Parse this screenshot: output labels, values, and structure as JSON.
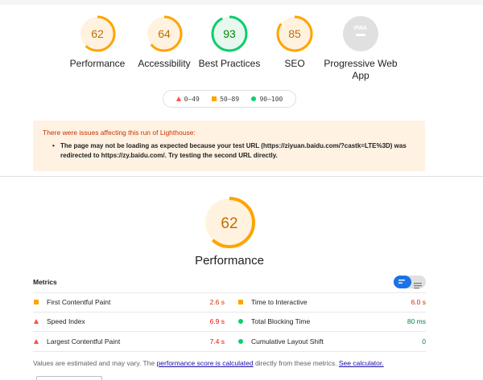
{
  "colors": {
    "orange": "#ffa400",
    "green": "#0cce6b",
    "red": "#ff4e42",
    "gray": "#9e9e9e",
    "link": "#1a0dab"
  },
  "summary": [
    {
      "score": "62",
      "label": "Performance",
      "status": "average",
      "fraction": 0.62
    },
    {
      "score": "64",
      "label": "Accessibility",
      "status": "average",
      "fraction": 0.64
    },
    {
      "score": "93",
      "label": "Best Practices",
      "status": "pass",
      "fraction": 0.93
    },
    {
      "score": "85",
      "label": "SEO",
      "status": "average",
      "fraction": 0.85
    },
    {
      "badge": "PWA",
      "label": "Progressive Web App",
      "status": "na"
    }
  ],
  "legend": [
    {
      "range": "0–49",
      "icon": "red-triangle-icon"
    },
    {
      "range": "50–89",
      "icon": "orange-square-icon"
    },
    {
      "range": "90–100",
      "icon": "green-circle-icon"
    }
  ],
  "warning": {
    "title": "There were issues affecting this run of Lighthouse:",
    "item": "The page may not be loading as expected because your test URL (https://ziyuan.baidu.com/?castk=LTE%3D) was redirected to https://zy.baidu.com/. Try testing the second URL directly."
  },
  "performance": {
    "score": "62",
    "fraction": 0.62,
    "title": "Performance"
  },
  "metrics": {
    "title": "Metrics",
    "items": [
      {
        "name": "First Contentful Paint",
        "value": "2.6 s",
        "status": "average"
      },
      {
        "name": "Time to Interactive",
        "value": "6.0 s",
        "status": "average"
      },
      {
        "name": "Speed Index",
        "value": "6.9 s",
        "status": "fail"
      },
      {
        "name": "Total Blocking Time",
        "value": "80 ms",
        "status": "pass"
      },
      {
        "name": "Largest Contentful Paint",
        "value": "7.4 s",
        "status": "fail"
      },
      {
        "name": "Cumulative Layout Shift",
        "value": "0",
        "status": "pass"
      }
    ]
  },
  "note": {
    "before": "Values are estimated and may vary. The ",
    "link1": "performance score is calculated",
    "middle": " directly from these metrics. ",
    "link2": "See calculator."
  }
}
